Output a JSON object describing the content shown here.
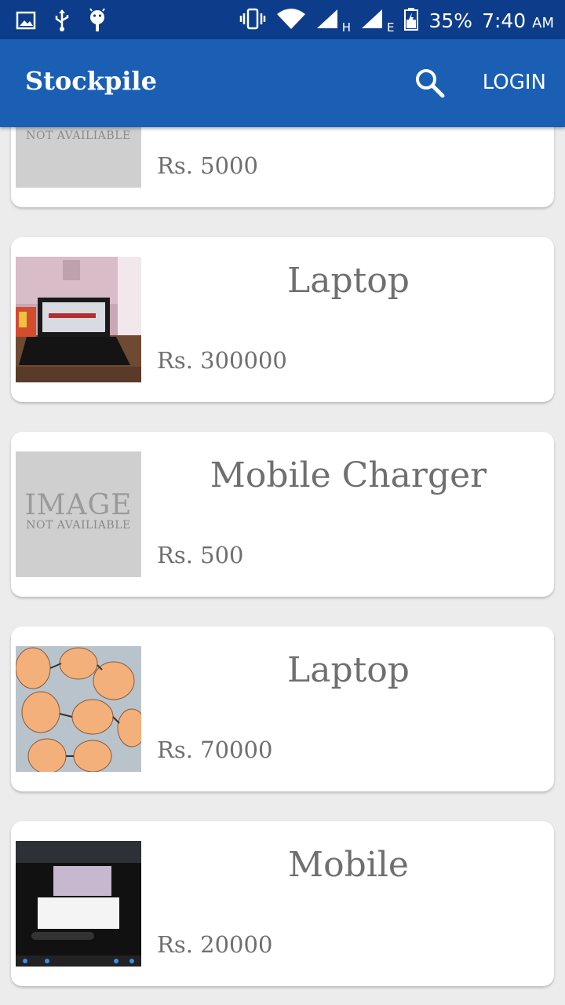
{
  "status_bar": {
    "battery": "35%",
    "time": "7:40",
    "ampm": "AM",
    "net1": "H",
    "net2": "E",
    "icons": [
      "image-icon",
      "usb-icon",
      "android-icon",
      "vibrate-icon",
      "wifi-icon",
      "signal-icon",
      "battery-icon"
    ]
  },
  "app_bar": {
    "title": "Stockpile",
    "login_label": "LOGIN",
    "color": "#1a5fb4"
  },
  "placeholder": {
    "big": "IMAGE",
    "small": "NOT AVAILIABLE"
  },
  "items": [
    {
      "title": "",
      "price": "Rs. 5000"
    },
    {
      "title": "Laptop",
      "price": "Rs. 300000"
    },
    {
      "title": "Mobile Charger",
      "price": "Rs. 500"
    },
    {
      "title": "Laptop",
      "price": "Rs. 70000"
    },
    {
      "title": "Mobile",
      "price": "Rs. 20000"
    }
  ]
}
